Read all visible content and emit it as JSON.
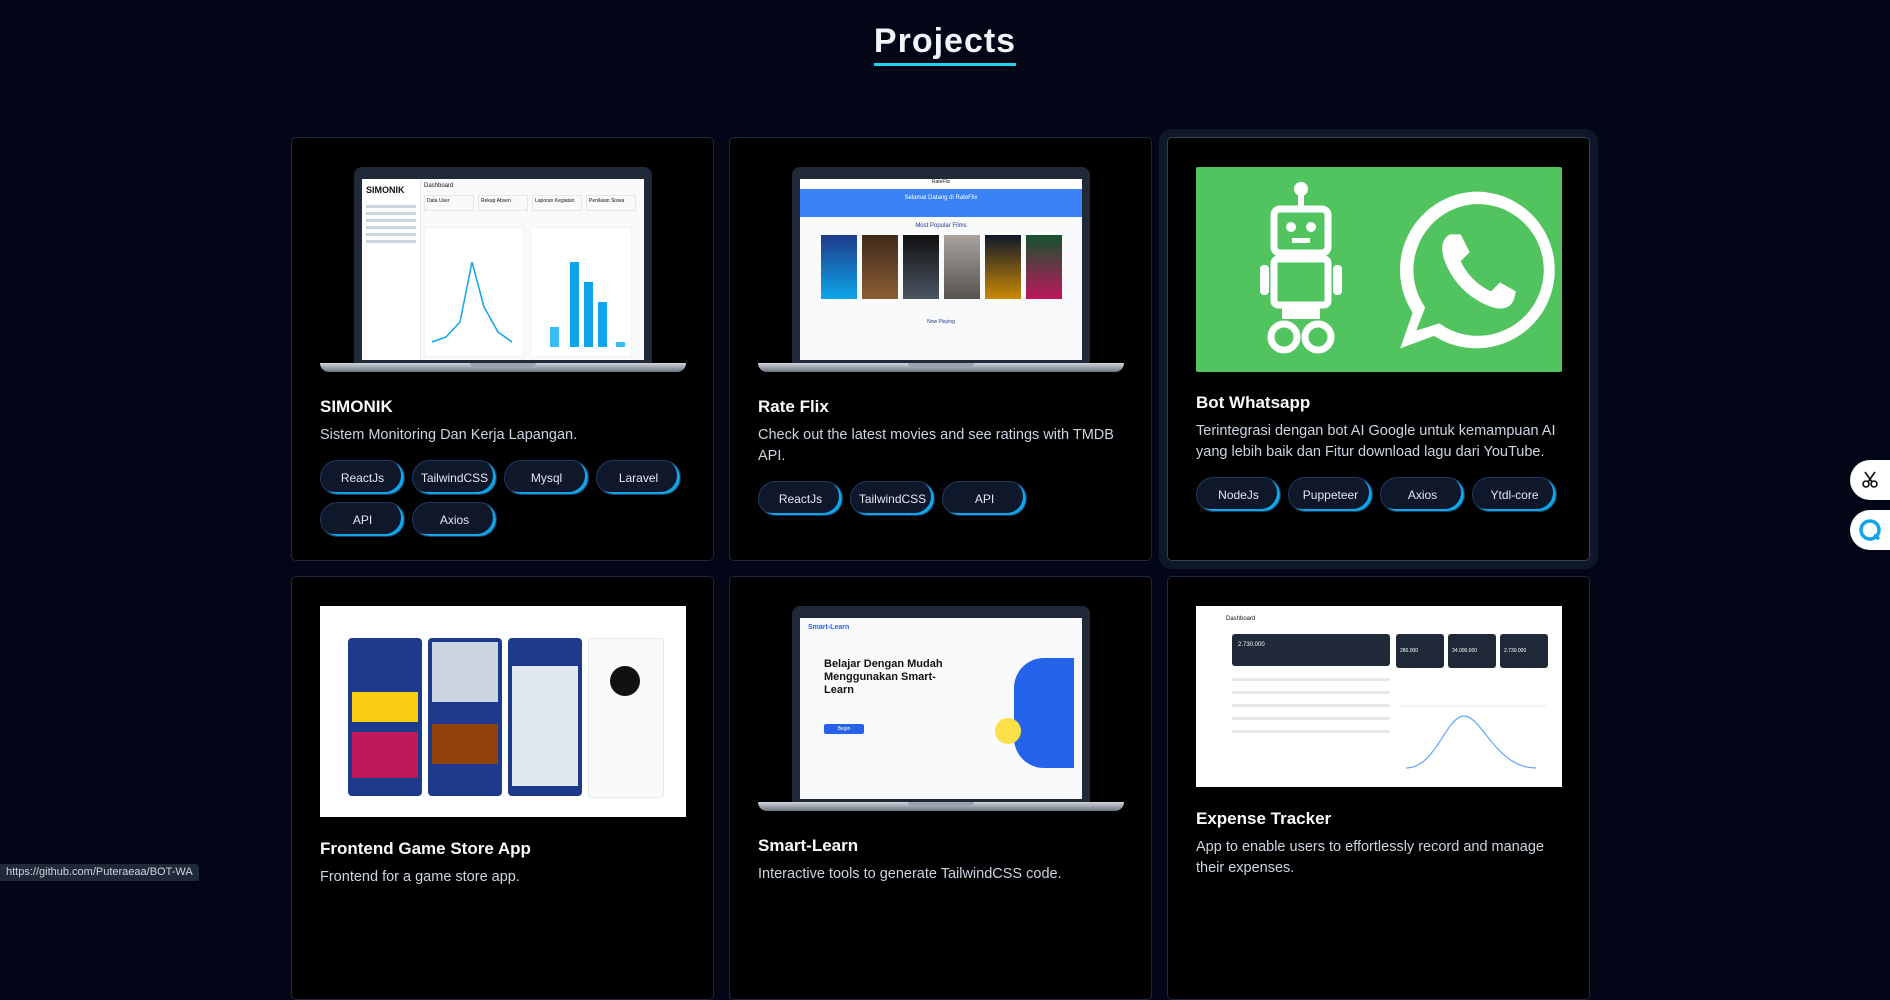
{
  "section_title": "Projects",
  "projects": [
    {
      "title": "SIMONIK",
      "description": "Sistem Monitoring Dan Kerja Lapangan.",
      "tags": [
        "ReactJs",
        "TailwindCSS",
        "Mysql",
        "Laravel",
        "API",
        "Axios"
      ],
      "thumbnail": {
        "brand": "SIMONIK",
        "heading": "Dashboard",
        "buttons": [
          "Data User",
          "Rekap Absen",
          "Laporan Kegiatan",
          "Penilaian Siswa"
        ]
      }
    },
    {
      "title": "Rate Flix",
      "description": "Check out the latest movies and see ratings with TMDB API.",
      "tags": [
        "ReactJs",
        "TailwindCSS",
        "API"
      ],
      "thumbnail": {
        "header": "RateFlix",
        "welcome": "Selamat Datang di RateFlix",
        "section": "Most Popular Films",
        "footer": "Now Playing"
      }
    },
    {
      "title": "Bot Whatsapp",
      "description": "Terintegrasi dengan bot AI Google untuk kemampuan AI yang lebih baik dan Fitur download lagu dari YouTube.",
      "tags": [
        "NodeJs",
        "Puppeteer",
        "Axios",
        "Ytdl-core"
      ]
    },
    {
      "title": "Frontend Game Store App",
      "description": "Frontend for a game store app.",
      "tags": []
    },
    {
      "title": "Smart-Learn",
      "description": "Interactive tools to generate TailwindCSS code.",
      "tags": [],
      "thumbnail": {
        "logo": "Smart-Learn",
        "headline": "Belajar Dengan Mudah Menggunakan Smart-Learn",
        "cta": "Begin"
      }
    },
    {
      "title": "Expense Tracker",
      "description": "App to enable users to effortlessly record and manage their expenses.",
      "tags": [],
      "thumbnail": {
        "heading": "Dashboard",
        "total": "2.730.000",
        "cards": [
          "280.000",
          "34.000.000",
          "2.730.000"
        ]
      }
    }
  ],
  "status_url": "https://github.com/Puteraeaa/BOT-WA",
  "colors": {
    "background": "#020617",
    "accent": "#22d3ee",
    "card": "#000000",
    "whatsapp": "#51c45f"
  }
}
